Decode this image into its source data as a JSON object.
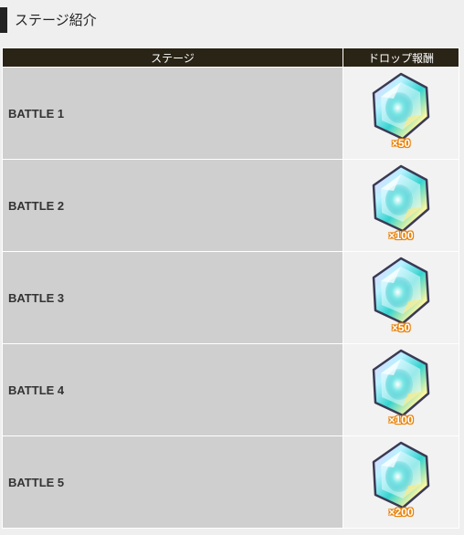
{
  "section": {
    "title": "ステージ紹介"
  },
  "table": {
    "headers": {
      "stage": "ステージ",
      "reward": "ドロップ報酬"
    },
    "rows": [
      {
        "stage": "BATTLE 1",
        "reward_icon": "rainbow-crystal-icon",
        "qty": "×50"
      },
      {
        "stage": "BATTLE 2",
        "reward_icon": "rainbow-crystal-icon",
        "qty": "×100"
      },
      {
        "stage": "BATTLE 3",
        "reward_icon": "rainbow-crystal-icon",
        "qty": "×50"
      },
      {
        "stage": "BATTLE 4",
        "reward_icon": "rainbow-crystal-icon",
        "qty": "×100"
      },
      {
        "stage": "BATTLE 5",
        "reward_icon": "rainbow-crystal-icon",
        "qty": "×200"
      }
    ]
  },
  "colors": {
    "header_bg": "#2a2416",
    "row_bg": "#cfcfcf",
    "reward_bg": "#f2f2f2",
    "qty_outline": "#f38a10"
  }
}
